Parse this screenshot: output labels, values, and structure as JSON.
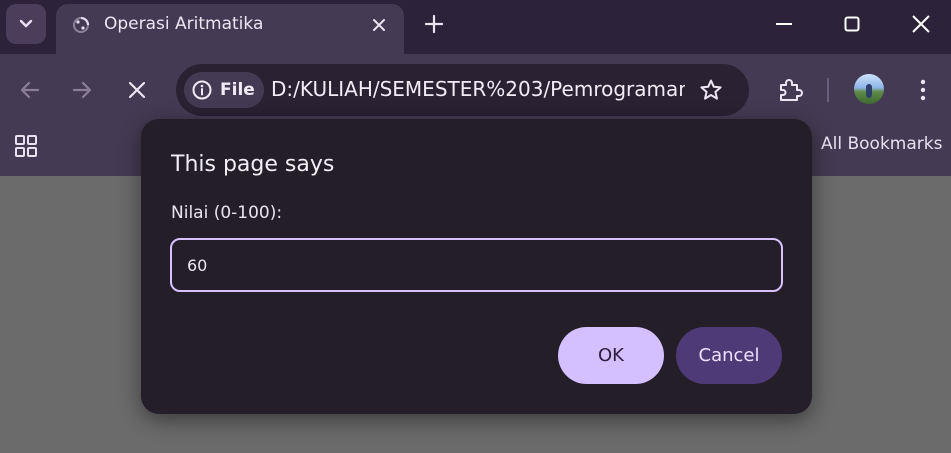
{
  "browser": {
    "tab": {
      "title": "Operasi Aritmatika"
    },
    "address_bar": {
      "chip_label": "File",
      "url": "D:/KULIAH/SEMESTER%203/Pemrograman..."
    },
    "bookmarks_bar": {
      "all_bookmarks_label": "All Bookmarks"
    },
    "icons": {
      "tab_search": "chevron-down-icon",
      "tab_close": "close-icon",
      "new_tab": "plus-icon",
      "minimize": "minimize-icon",
      "maximize": "maximize-icon",
      "window_close": "close-icon",
      "back": "arrow-left-icon",
      "forward": "arrow-right-icon",
      "stop": "close-icon",
      "site_info": "info-icon",
      "bookmark_star": "star-icon",
      "extensions": "puzzle-icon",
      "menu": "kebab-menu-icon",
      "apps": "apps-grid-icon"
    }
  },
  "dialog": {
    "title": "This page says",
    "message": "Nilai (0-100):",
    "input_value": "60",
    "ok_label": "OK",
    "cancel_label": "Cancel"
  },
  "colors": {
    "tabstrip_bg": "#2c2239",
    "toolbar_bg": "#453a53",
    "page_bg": "#6b6b6b",
    "dialog_bg": "#231e28",
    "input_focus_border": "#d7c2ff",
    "ok_button": "#d4bfff",
    "cancel_button": "#4f3a78"
  }
}
